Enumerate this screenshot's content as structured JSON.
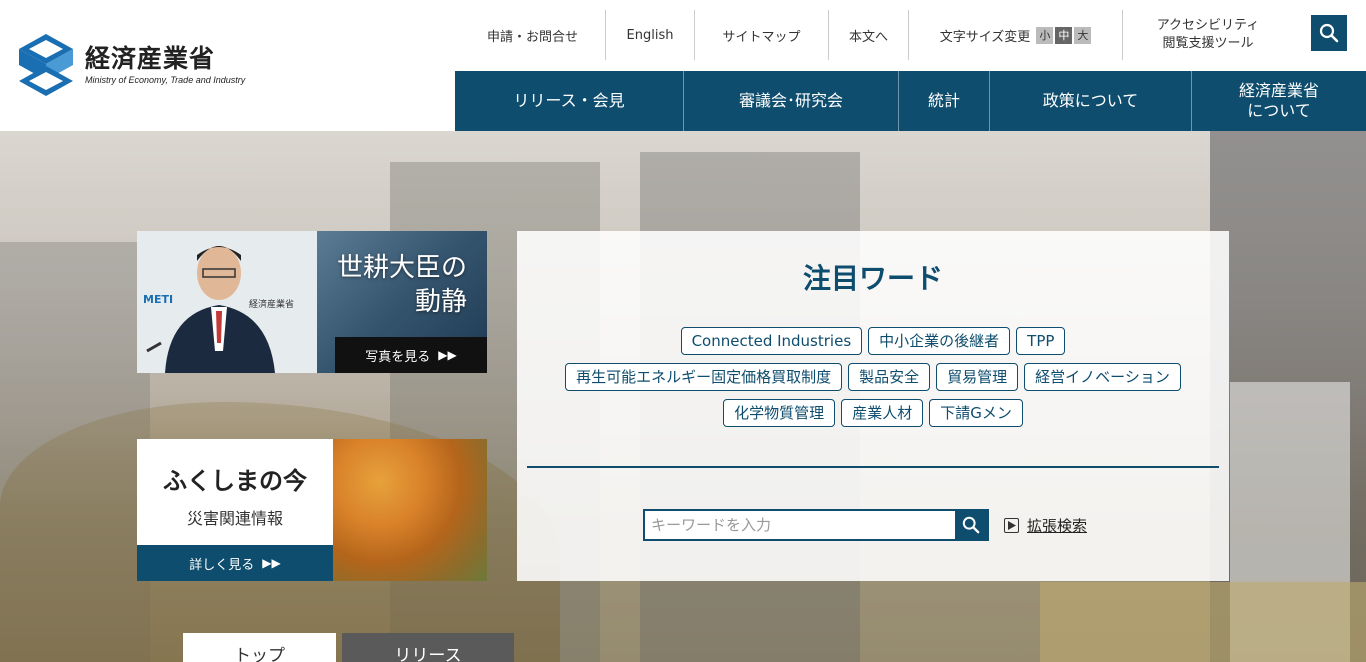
{
  "logo": {
    "jp": "経済産業省",
    "en": "Ministry of Economy, Trade and Industry"
  },
  "util_nav": {
    "contact": "申請・お問合せ",
    "english": "English",
    "sitemap": "サイトマップ",
    "skip": "本文へ",
    "font_size_label": "文字サイズ変更",
    "font_small": "小",
    "font_medium": "中",
    "font_large": "大",
    "access_line1": "アクセシビリティ",
    "access_line2": "閲覧支援ツール"
  },
  "main_nav": {
    "items": [
      "リリース・会見",
      "審議会･研究会",
      "統計",
      "政策について"
    ],
    "about_line1": "経済産業省",
    "about_line2": "について"
  },
  "minister_card": {
    "title_line1": "世耕大臣の",
    "title_line2": "動静",
    "more": "写真を見る",
    "badge": "METI",
    "badge_jp": "経済産業省"
  },
  "fukushima_card": {
    "title": "ふくしまの今",
    "subtitle": "災害関連情報",
    "more": "詳しく見る"
  },
  "words": {
    "title": "注目ワード",
    "tags": [
      "Connected Industries",
      "中小企業の後継者",
      "TPP",
      "再生可能エネルギー固定価格買取制度",
      "製品安全",
      "貿易管理",
      "経営イノベーション",
      "化学物質管理",
      "産業人材",
      "下請Gメン"
    ]
  },
  "search": {
    "placeholder": "キーワードを入力",
    "advanced": "拡張検索"
  },
  "tabs": {
    "top": "トップ",
    "release": "リリース"
  },
  "colors": {
    "brand": "#0e4d6e",
    "logo_blue": "#1a6fb3"
  }
}
